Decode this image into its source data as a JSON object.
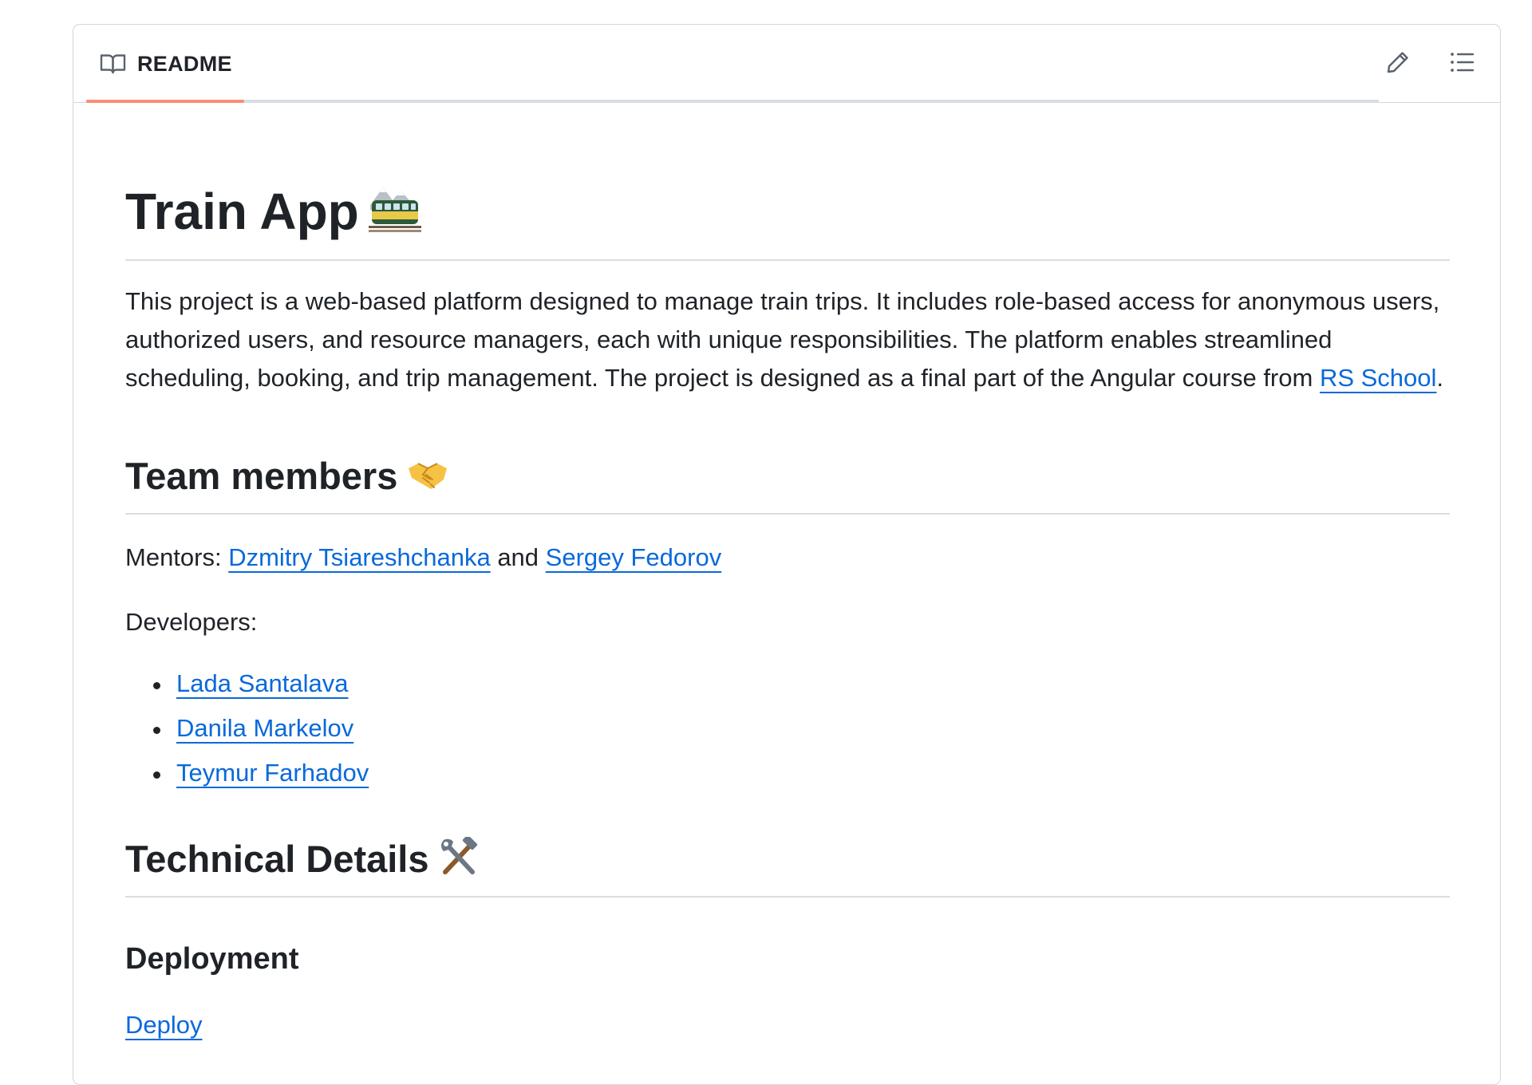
{
  "header": {
    "tab_label": "README",
    "book_icon": "book-icon",
    "edit_icon": "pencil-icon",
    "outline_icon": "list-unordered-icon"
  },
  "colors": {
    "link": "#0969da",
    "tab_underline": "#fd8c73",
    "border": "#d0d7de",
    "text": "#1f2328"
  },
  "readme": {
    "title": "Train App",
    "title_emoji": "mountain-railway-emoji",
    "intro": {
      "before_link": "This project is a web-based platform designed to manage train trips. It includes role-based access for anonymous users, authorized users, and resource managers, each with unique responsibilities. The platform enables streamlined scheduling, booking, and trip management. The project is designed as a final part of the Angular course from ",
      "link": "RS School",
      "after_link": "."
    },
    "team": {
      "heading": "Team members",
      "heading_emoji": "handshake-emoji",
      "mentors_label": "Mentors: ",
      "mentor_1": "Dzmitry Tsiareshchanka",
      "mentors_and": " and ",
      "mentor_2": "Sergey Fedorov",
      "developers_label": "Developers:",
      "developers": [
        "Lada Santalava",
        "Danila Markelov",
        "Teymur Farhadov"
      ]
    },
    "technical": {
      "heading": "Technical Details",
      "heading_emoji": "hammer-and-wrench-emoji",
      "deployment_heading": "Deployment",
      "deploy_link": "Deploy"
    }
  }
}
